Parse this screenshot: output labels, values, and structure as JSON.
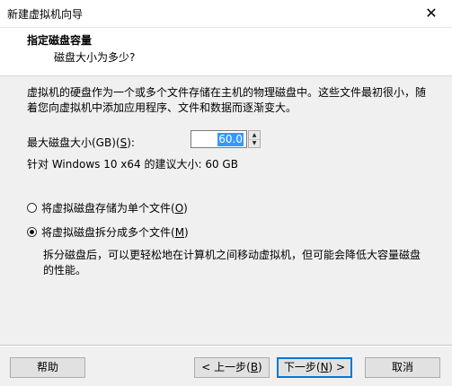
{
  "window": {
    "title": "新建虚拟机向导",
    "close_glyph": "✕"
  },
  "header": {
    "title": "指定磁盘容量",
    "subtitle": "磁盘大小为多少?"
  },
  "description": "虚拟机的硬盘作为一个或多个文件存储在主机的物理磁盘中。这些文件最初很小，随着您向虚拟机中添加应用程序、文件和数据而逐渐变大。",
  "disk_size": {
    "label_pre": "最大磁盘大小(GB)(",
    "label_key": "S",
    "label_post": "):",
    "value": "60.0",
    "up_glyph": "▲",
    "down_glyph": "▼"
  },
  "recommended": "针对 Windows 10 x64 的建议大小: 60 GB",
  "options": [
    {
      "label_pre": "将虚拟磁盘存储为单个文件(",
      "label_key": "O",
      "label_post": ")",
      "checked": false
    },
    {
      "label_pre": "将虚拟磁盘拆分成多个文件(",
      "label_key": "M",
      "label_post": ")",
      "checked": true
    }
  ],
  "split_description": "拆分磁盘后，可以更轻松地在计算机之间移动虚拟机，但可能会降低大容量磁盘的性能。",
  "buttons": {
    "help": "帮助",
    "back_pre": "< 上一步(",
    "back_key": "B",
    "back_post": ")",
    "next_pre": "下一步(",
    "next_key": "N",
    "next_post": ") >",
    "cancel": "取消"
  }
}
